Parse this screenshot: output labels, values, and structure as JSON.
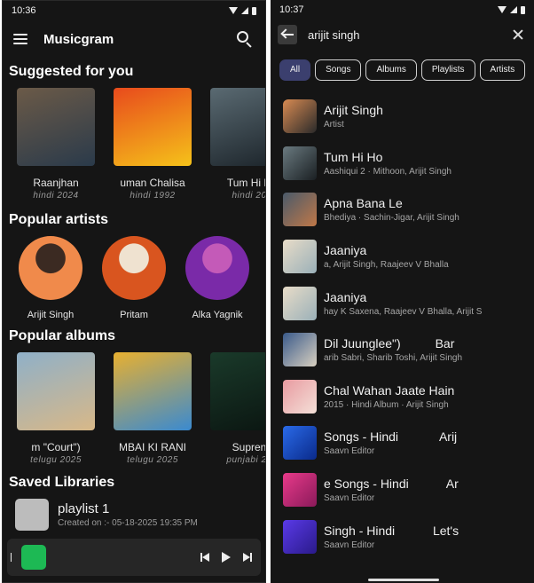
{
  "left": {
    "status": {
      "time": "10:36"
    },
    "app_title": "Musicgram",
    "sections": {
      "suggested": "Suggested for you",
      "artists": "Popular artists",
      "albums": "Popular albums",
      "saved": "Saved Libraries"
    },
    "suggested": [
      {
        "title": "Raanjhan",
        "sub": "hindi 2024",
        "art": "do-patti-poster",
        "c1": "#6b5a48",
        "c2": "#2a3a4a"
      },
      {
        "title": "uman Chalisa",
        "sub": "hindi 1992",
        "art": "hanuman-chalisa-cover",
        "c1": "#e84a1c",
        "c2": "#f5c21a"
      },
      {
        "title": "Tum Hi H",
        "sub": "hindi 20",
        "art": "aashiqui-2-cover",
        "c1": "#5a6a72",
        "c2": "#1a2228"
      }
    ],
    "artists": [
      {
        "name": "Arijit Singh",
        "c1": "#f08a4b",
        "c2": "#3b2a22"
      },
      {
        "name": "Pritam",
        "c1": "#d9551f",
        "c2": "#efe2d0"
      },
      {
        "name": "Alka Yagnik",
        "c1": "#7a2aa8",
        "c2": "#c45ab8"
      }
    ],
    "albums": [
      {
        "title": "m \"Court\")",
        "sub": "telugu 2025",
        "art": "court-poster",
        "c1": "#8fb0c8",
        "c2": "#d8b888"
      },
      {
        "title": "MBAI KI RANI",
        "sub": "telugu 2025",
        "art": "telugu-film-poster",
        "c1": "#e8b030",
        "c2": "#3a8ad0"
      },
      {
        "title": "Supren",
        "sub": "punjabi 20",
        "art": "dark-green-cover",
        "c1": "#1a3a2a",
        "c2": "#0a1410"
      }
    ],
    "library": {
      "name": "playlist 1",
      "meta": "Created on :- 05-18-2025 19:35 PM"
    }
  },
  "right": {
    "status": {
      "time": "10:37"
    },
    "query": "arijit singh",
    "chips": [
      {
        "label": "All",
        "active": true
      },
      {
        "label": "Songs",
        "active": false
      },
      {
        "label": "Albums",
        "active": false
      },
      {
        "label": "Playlists",
        "active": false
      },
      {
        "label": "Artists",
        "active": false
      }
    ],
    "results": [
      {
        "title": "Arijit Singh",
        "sub": "Artist",
        "c1": "#d88a52",
        "c2": "#2a2a2a"
      },
      {
        "title": "Tum Hi Ho",
        "sub": "Aashiqui 2 · Mithoon, Arijit Singh",
        "c1": "#6a7a80",
        "c2": "#1a1f22"
      },
      {
        "title": "Apna Bana Le",
        "sub": "Bhediya · Sachin-Jigar, Arijit Singh",
        "c1": "#4a5a6a",
        "c2": "#c07848"
      },
      {
        "title": "Jaaniya",
        "sub": "a, Arijit Singh, Raajeev V Bhalla",
        "c1": "#e8dcc8",
        "c2": "#9ab0b8"
      },
      {
        "title": "Jaaniya",
        "sub": "hay K Saxena, Raajeev V Bhalla, Arijit S",
        "c1": "#e8dcc8",
        "c2": "#9ab0b8"
      },
      {
        "title": "Dil Juunglee\")          Bar",
        "sub": "arib Sabri, Sharib Toshi, Arijit Singh",
        "c1": "#3a5a8a",
        "c2": "#d8d0c0"
      },
      {
        "title": "Chal Wahan Jaate Hain",
        "sub": "2015 · Hindi Album · Arijit Singh",
        "c1": "#e89aa0",
        "c2": "#f4e0d8"
      },
      {
        "title": "Songs - Hindi            Arij",
        "sub": "Saavn Editor",
        "c1": "#2a6ae8",
        "c2": "#0a2a8a"
      },
      {
        "title": "e Songs - Hindi           Ar",
        "sub": "Saavn Editor",
        "c1": "#e83a8a",
        "c2": "#8a1a5a"
      },
      {
        "title": "Singh - Hindi           Let's",
        "sub": "Saavn Editor",
        "c1": "#5a3ae8",
        "c2": "#2a1a8a"
      }
    ]
  }
}
